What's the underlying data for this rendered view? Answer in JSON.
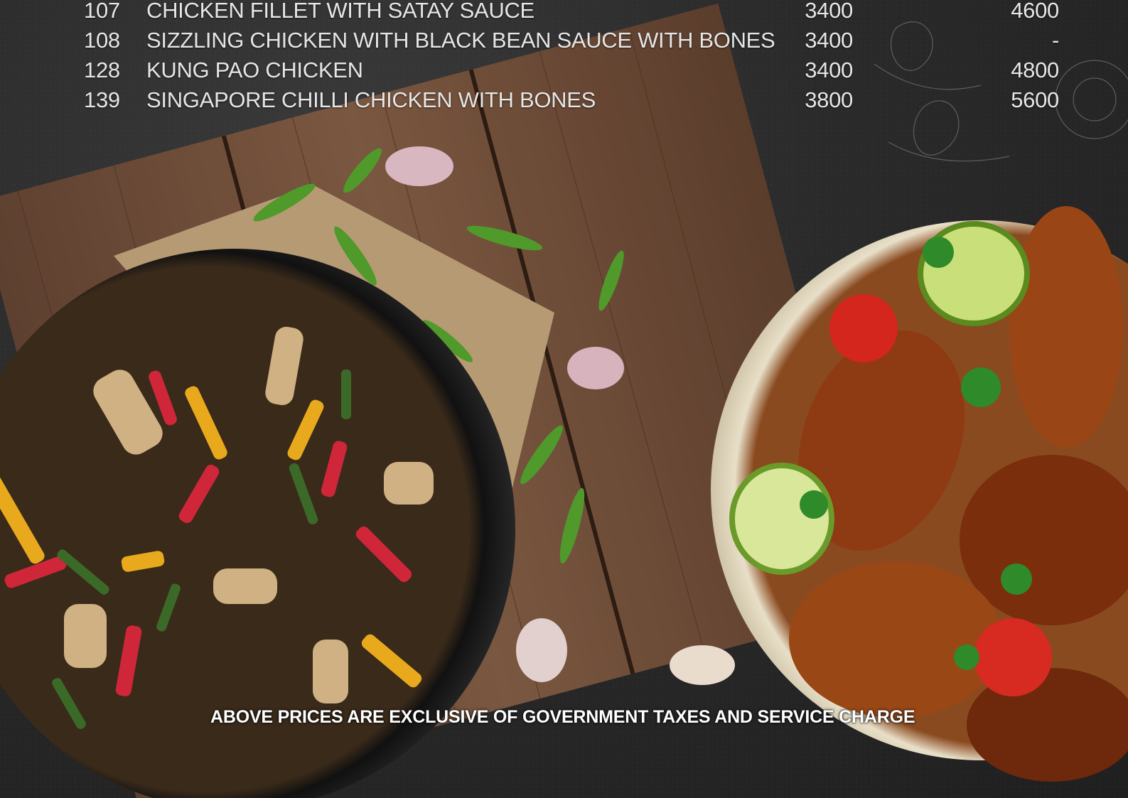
{
  "menu_items": [
    {
      "code": "107",
      "name": "CHICKEN FILLET WITH SATAY SAUCE",
      "price_1": "3400",
      "price_2": "4600"
    },
    {
      "code": "108",
      "name": "SIZZLING CHICKEN WITH BLACK BEAN SAUCE WITH BONES",
      "price_1": "3400",
      "price_2": "-"
    },
    {
      "code": "128",
      "name": "KUNG PAO CHICKEN",
      "price_1": "3400",
      "price_2": "4800"
    },
    {
      "code": "139",
      "name": "SINGAPORE  CHILLI CHICKEN WITH BONES",
      "price_1": "3800",
      "price_2": "5600"
    }
  ],
  "footer": {
    "note": "ABOVE PRICES ARE EXCLUSIVE OF GOVERNMENT TAXES AND SERVICE CHARGE"
  },
  "colors": {
    "background": "#2b2b2b",
    "text": "#e6e6e6",
    "wood": "#6b4a33",
    "pan": "#1a1a1a",
    "bowl": "#efe7d2"
  }
}
